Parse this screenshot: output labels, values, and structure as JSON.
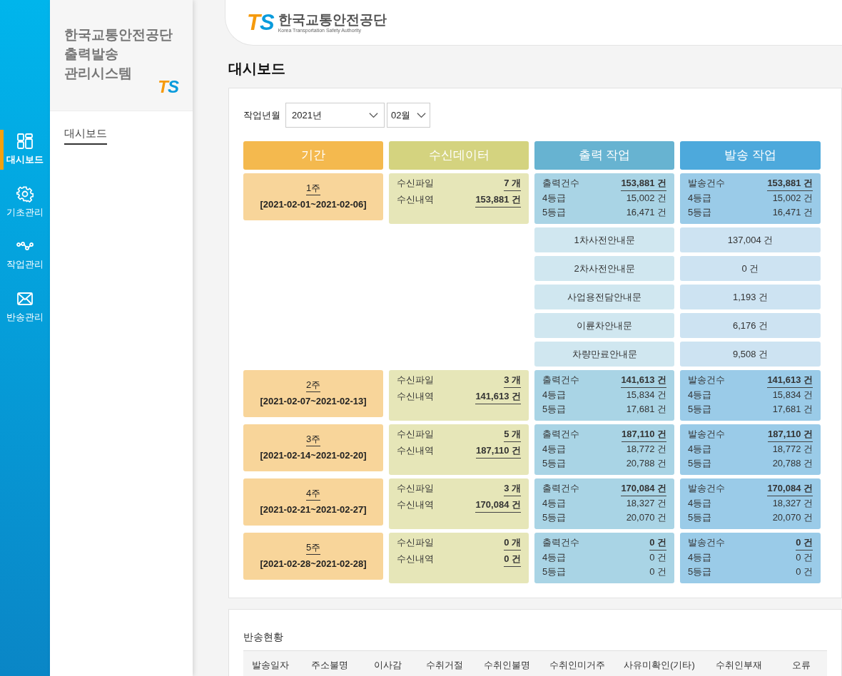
{
  "nav_rail": [
    {
      "label": "대시보드",
      "kind": "grid",
      "selected": true
    },
    {
      "label": "기초관리",
      "kind": "gear",
      "selected": false
    },
    {
      "label": "작업관리",
      "kind": "nodes",
      "selected": false
    },
    {
      "label": "반송관리",
      "kind": "mail",
      "selected": false
    }
  ],
  "sidebar": {
    "title_lines": [
      "한국교통안전공단",
      "출력발송",
      "관리시스템"
    ],
    "logo": "TS",
    "menu": [
      {
        "label": "대시보드",
        "selected": true
      }
    ]
  },
  "header": {
    "logo": "TS",
    "org_name": "한국교통안전공단",
    "org_name_en": "Korea Transportation Safety Authority"
  },
  "page_title": "대시보드",
  "filter": {
    "label": "작업년월",
    "year": "2021년",
    "month": "02월"
  },
  "columns": [
    "기간",
    "수신데이터",
    "출력 작업",
    "발송 작업"
  ],
  "weeks": [
    {
      "week": "1주",
      "range": "[2021-02-01~2021-02-06]",
      "received": [
        {
          "label": "수신파일",
          "value": "7 개"
        },
        {
          "label": "수신내역",
          "value": "153,881 건"
        }
      ],
      "output": [
        {
          "label": "출력건수",
          "value": "153,881 건"
        },
        {
          "label": "4등급",
          "value": "15,002 건"
        },
        {
          "label": "5등급",
          "value": "16,471 건"
        }
      ],
      "dispatch": [
        {
          "label": "발송건수",
          "value": "153,881 건"
        },
        {
          "label": "4등급",
          "value": "15,002 건"
        },
        {
          "label": "5등급",
          "value": "16,471 건"
        }
      ],
      "notices": [
        {
          "label": "1차사전안내문",
          "value": "137,004 건"
        },
        {
          "label": "2차사전안내문",
          "value": "0 건"
        },
        {
          "label": "사업용전담안내문",
          "value": "1,193 건"
        },
        {
          "label": "이륜차안내문",
          "value": "6,176 건"
        },
        {
          "label": "차량만료안내문",
          "value": "9,508 건"
        }
      ]
    },
    {
      "week": "2주",
      "range": "[2021-02-07~2021-02-13]",
      "received": [
        {
          "label": "수신파일",
          "value": "3 개"
        },
        {
          "label": "수신내역",
          "value": "141,613 건"
        }
      ],
      "output": [
        {
          "label": "출력건수",
          "value": "141,613 건"
        },
        {
          "label": "4등급",
          "value": "15,834 건"
        },
        {
          "label": "5등급",
          "value": "17,681 건"
        }
      ],
      "dispatch": [
        {
          "label": "발송건수",
          "value": "141,613 건"
        },
        {
          "label": "4등급",
          "value": "15,834 건"
        },
        {
          "label": "5등급",
          "value": "17,681 건"
        }
      ]
    },
    {
      "week": "3주",
      "range": "[2021-02-14~2021-02-20]",
      "received": [
        {
          "label": "수신파일",
          "value": "5 개"
        },
        {
          "label": "수신내역",
          "value": "187,110 건"
        }
      ],
      "output": [
        {
          "label": "출력건수",
          "value": "187,110 건"
        },
        {
          "label": "4등급",
          "value": "18,772 건"
        },
        {
          "label": "5등급",
          "value": "20,788 건"
        }
      ],
      "dispatch": [
        {
          "label": "발송건수",
          "value": "187,110 건"
        },
        {
          "label": "4등급",
          "value": "18,772 건"
        },
        {
          "label": "5등급",
          "value": "20,788 건"
        }
      ]
    },
    {
      "week": "4주",
      "range": "[2021-02-21~2021-02-27]",
      "received": [
        {
          "label": "수신파일",
          "value": "3 개"
        },
        {
          "label": "수신내역",
          "value": "170,084 건"
        }
      ],
      "output": [
        {
          "label": "출력건수",
          "value": "170,084 건"
        },
        {
          "label": "4등급",
          "value": "18,327 건"
        },
        {
          "label": "5등급",
          "value": "20,070 건"
        }
      ],
      "dispatch": [
        {
          "label": "발송건수",
          "value": "170,084 건"
        },
        {
          "label": "4등급",
          "value": "18,327 건"
        },
        {
          "label": "5등급",
          "value": "20,070 건"
        }
      ]
    },
    {
      "week": "5주",
      "range": "[2021-02-28~2021-02-28]",
      "received": [
        {
          "label": "수신파일",
          "value": "0 개"
        },
        {
          "label": "수신내역",
          "value": "0 건"
        }
      ],
      "output": [
        {
          "label": "출력건수",
          "value": "0 건"
        },
        {
          "label": "4등급",
          "value": "0 건"
        },
        {
          "label": "5등급",
          "value": "0 건"
        }
      ],
      "dispatch": [
        {
          "label": "발송건수",
          "value": "0 건"
        },
        {
          "label": "4등급",
          "value": "0 건"
        },
        {
          "label": "5등급",
          "value": "0 건"
        }
      ]
    }
  ],
  "returns": {
    "title": "반송현황",
    "columns": [
      "발송일자",
      "주소불명",
      "이사감",
      "수취거절",
      "수취인불명",
      "수취인미거주",
      "사유미확인(기타)",
      "수취인부재",
      "오류"
    ]
  }
}
